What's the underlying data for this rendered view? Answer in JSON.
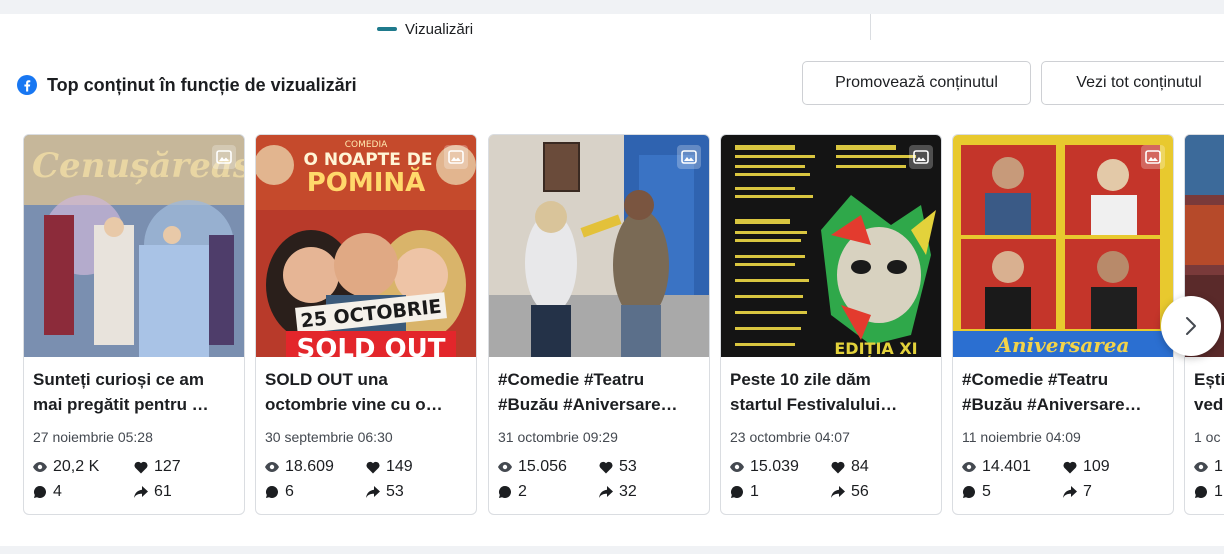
{
  "chart_legend": {
    "label": "Vizualizări",
    "color": "#1f7a8c"
  },
  "section": {
    "title": "Top conținut în funcție de vizualizări",
    "icon": "facebook-icon"
  },
  "actions": {
    "promote_label": "Promovează conținutul",
    "view_all_label": "Vezi tot conținutul"
  },
  "posts": [
    {
      "title_line1": "Sunteți curioși ce am",
      "title_line2": "mai pregătit pentru …",
      "date": "27 noiembrie 05:28",
      "views": "20,2 K",
      "likes": "127",
      "comments": "4",
      "shares": "61",
      "thumb_text1": "Cenușăreasa",
      "thumb_text2": "",
      "thumb_text3": ""
    },
    {
      "title_line1": "SOLD OUT una",
      "title_line2": "octombrie vine cu o…",
      "date": "30 septembrie 06:30",
      "views": "18.609",
      "likes": "149",
      "comments": "6",
      "shares": "53",
      "thumb_text1": "O NOAPTE DE",
      "thumb_text2": "POMINĂ",
      "thumb_text3": "25 OCTOBRIE",
      "thumb_text4": "SOLD OUT",
      "thumb_text5": "COMEDIA"
    },
    {
      "title_line1": "#Comedie #Teatru",
      "title_line2": "#Buzău #Aniversare…",
      "date": "31 octombrie 09:29",
      "views": "15.056",
      "likes": "53",
      "comments": "2",
      "shares": "32"
    },
    {
      "title_line1": "Peste 10 zile dăm",
      "title_line2": "startul Festivalului…",
      "date": "23 octombrie 04:07",
      "views": "15.039",
      "likes": "84",
      "comments": "1",
      "shares": "56",
      "thumb_text1": "EDIȚIA XI"
    },
    {
      "title_line1": "#Comedie #Teatru",
      "title_line2": "#Buzău #Aniversare…",
      "date": "11 noiembrie 04:09",
      "views": "14.401",
      "likes": "109",
      "comments": "5",
      "shares": "7",
      "thumb_text1": "Aniversarea"
    },
    {
      "title_line1": "Ești",
      "title_line2": "ved",
      "date": "1 oc",
      "views": "1",
      "likes": "",
      "comments": "1",
      "shares": ""
    }
  ],
  "icons": {
    "views": "eye-icon",
    "likes": "heart-icon",
    "comments": "comment-icon",
    "shares": "share-icon",
    "media": "photo-icon",
    "next": "chevron-right-icon"
  }
}
